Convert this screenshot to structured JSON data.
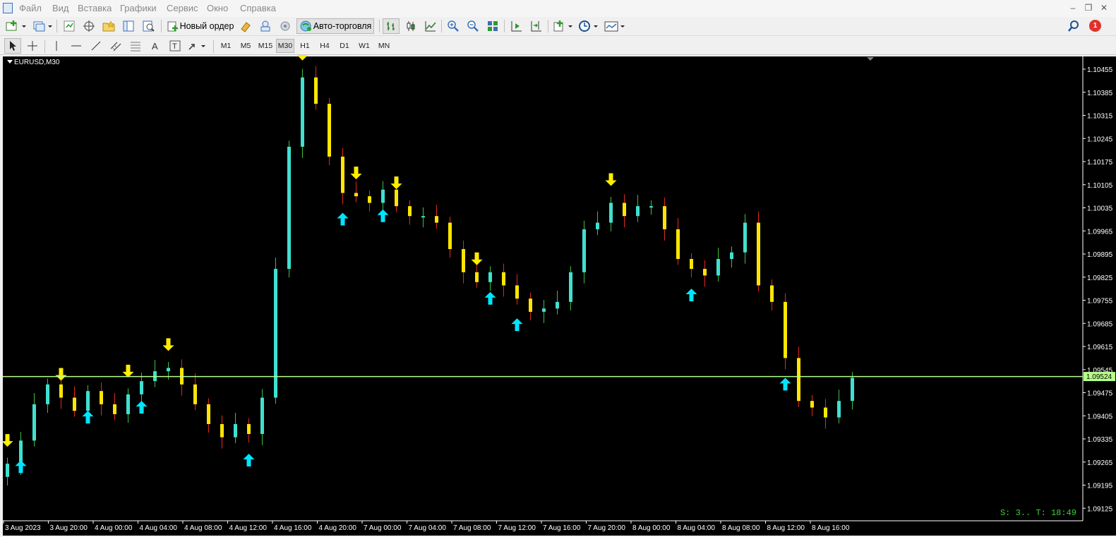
{
  "menu": {
    "items": [
      "Файл",
      "Вид",
      "Вставка",
      "Графики",
      "Сервис",
      "Окно",
      "Справка"
    ]
  },
  "toolbar": {
    "new_order_label": "Новый ордер",
    "autotrading_label": "Авто-торговля",
    "notification_count": "1"
  },
  "timeframes": {
    "items": [
      "M1",
      "M5",
      "M15",
      "M30",
      "H1",
      "H4",
      "D1",
      "W1",
      "MN"
    ],
    "active": "M30"
  },
  "chart": {
    "symbol_label": "EURUSD,M30",
    "price_labels": [
      "1.10455",
      "1.10385",
      "1.10315",
      "1.10245",
      "1.10175",
      "1.10105",
      "1.10035",
      "1.09965",
      "1.09895",
      "1.09825",
      "1.09755",
      "1.09685",
      "1.09615",
      "1.09545",
      "1.09475",
      "1.09405",
      "1.09335",
      "1.09265",
      "1.09195",
      "1.09125"
    ],
    "time_labels": [
      "3 Aug 2023",
      "3 Aug 20:00",
      "4 Aug 00:00",
      "4 Aug 04:00",
      "4 Aug 08:00",
      "4 Aug 12:00",
      "4 Aug 16:00",
      "4 Aug 20:00",
      "7 Aug 00:00",
      "7 Aug 04:00",
      "7 Aug 08:00",
      "7 Aug 12:00",
      "7 Aug 16:00",
      "7 Aug 20:00",
      "8 Aug 00:00",
      "8 Aug 04:00",
      "8 Aug 08:00",
      "8 Aug 12:00",
      "8 Aug 16:00"
    ],
    "current_price_label": "1.09524",
    "status_text": "S: 3.. T: 18:49",
    "colors": {
      "background": "#000000",
      "bull": "#40e0d0",
      "bear": "#ffe600",
      "bull_wick": "#3fbf3f",
      "bear_wick": "#e02a1a",
      "buy_arrow": "#00e5ff",
      "sell_arrow": "#ffee00",
      "price_line": "#b8ff8a",
      "axis_text": "#ffffff",
      "status_text": "#3cd13c"
    }
  },
  "chart_data": {
    "type": "candlestick",
    "symbol": "EURUSD",
    "timeframe": "M30",
    "ylim": [
      1.09125,
      1.10455
    ],
    "current_price": 1.09524,
    "candles_close": [
      1.0926,
      1.0933,
      1.0944,
      1.095,
      1.0946,
      1.0942,
      1.0948,
      1.0944,
      1.0941,
      1.0947,
      1.0951,
      1.0954,
      1.0955,
      1.095,
      1.0944,
      1.0938,
      1.0934,
      1.0938,
      1.0935,
      1.0946,
      1.0985,
      1.1022,
      1.1043,
      1.1035,
      1.1019,
      1.1008,
      1.1007,
      1.1005,
      1.1009,
      1.1004,
      1.1001,
      1.1001,
      1.0999,
      1.0991,
      1.0984,
      1.0981,
      1.0984,
      1.098,
      1.0976,
      1.0972,
      1.0973,
      1.0975,
      1.0984,
      1.0997,
      1.0999,
      1.1005,
      1.1001,
      1.1004,
      1.1004,
      1.0997,
      1.0988,
      1.0985,
      1.0983,
      1.0988,
      1.099,
      1.0999,
      1.098,
      1.0975,
      1.0958,
      1.0945,
      1.0943,
      1.094,
      1.0945,
      1.0952
    ],
    "buy_signal_count": 10,
    "sell_signal_count": 9
  }
}
